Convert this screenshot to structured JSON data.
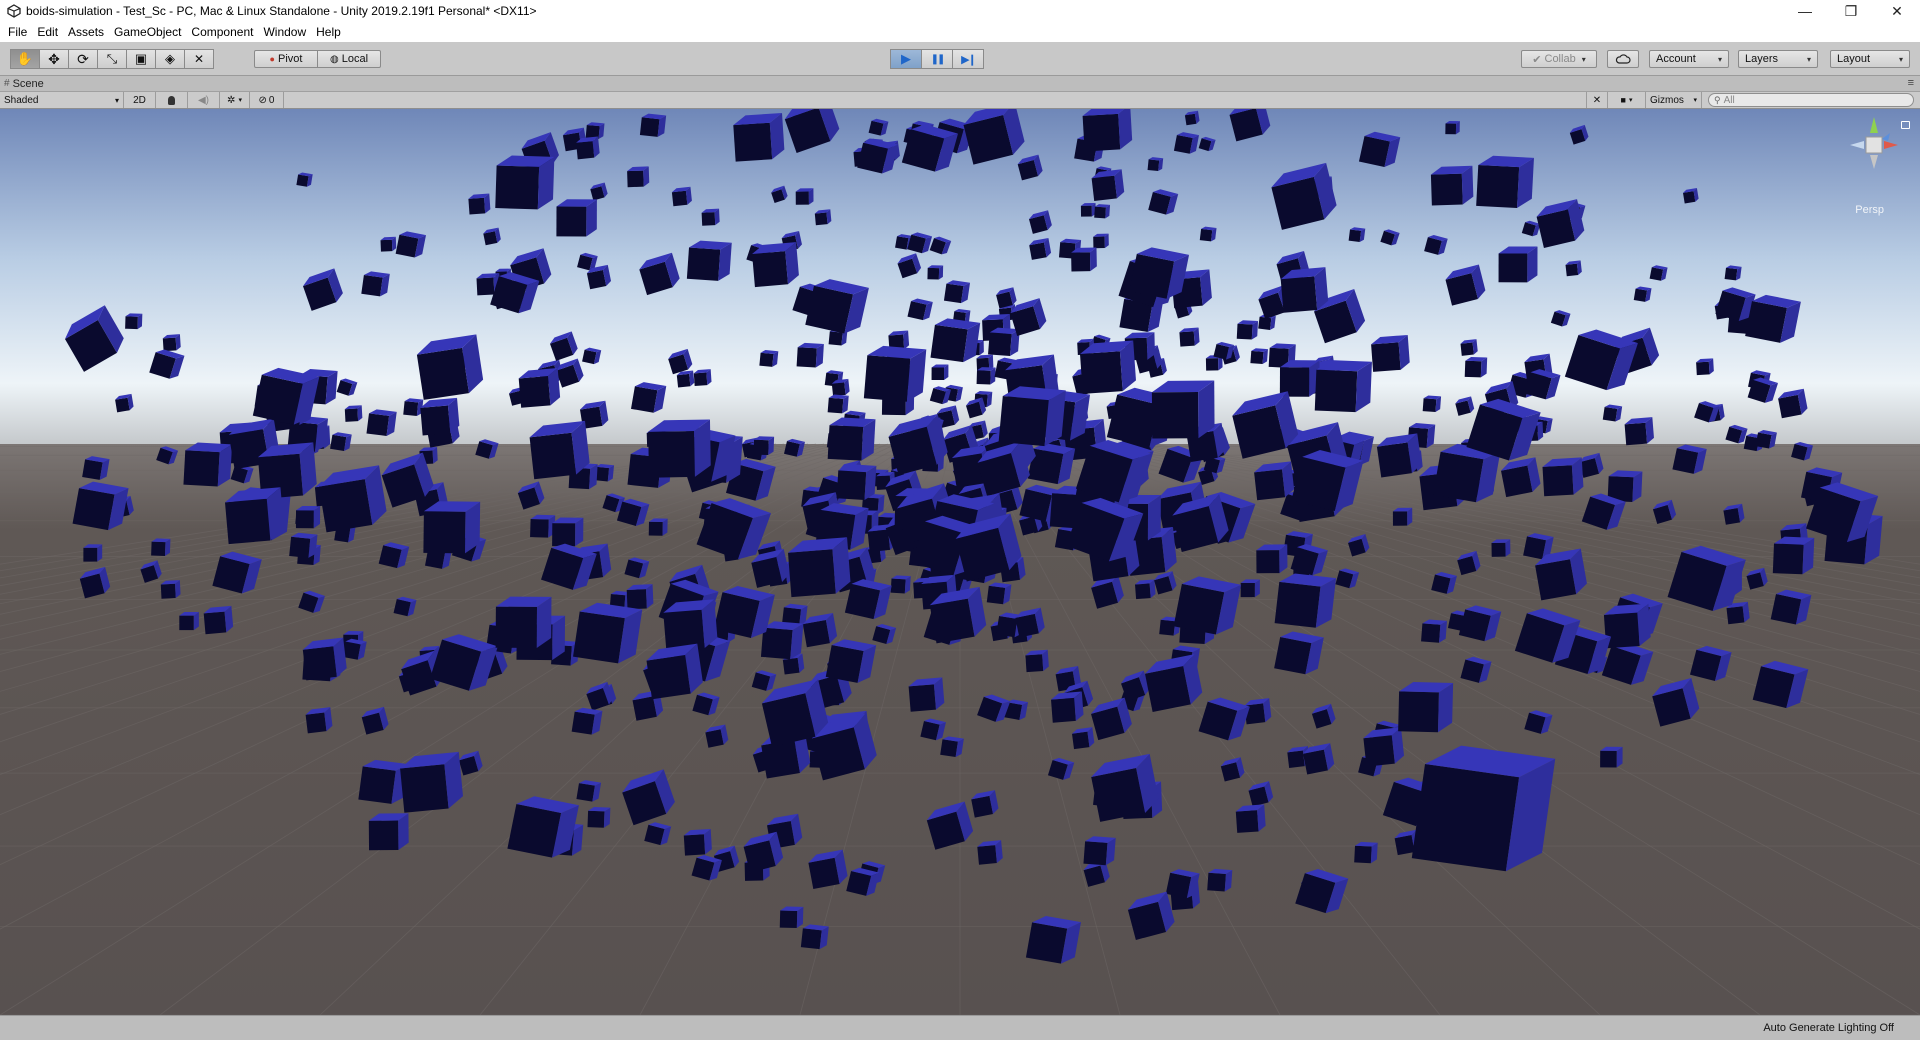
{
  "window": {
    "title": "boids-simulation - Test_Sc - PC, Mac & Linux Standalone - Unity 2019.2.19f1 Personal* <DX11>",
    "minimize_glyph": "—",
    "maximize_glyph": "❐",
    "close_glyph": "✕"
  },
  "menu": {
    "items": [
      "File",
      "Edit",
      "Assets",
      "GameObject",
      "Component",
      "Window",
      "Help"
    ]
  },
  "toolbar": {
    "transform_tools": [
      {
        "name": "hand-tool",
        "icon": "hand-icon",
        "glyph": "✋",
        "active": true
      },
      {
        "name": "move-tool",
        "icon": "move-icon",
        "glyph": "✥",
        "active": false
      },
      {
        "name": "rotate-tool",
        "icon": "rotate-icon",
        "glyph": "⟳",
        "active": false
      },
      {
        "name": "scale-tool",
        "icon": "scale-icon",
        "glyph": "⤡",
        "active": false
      },
      {
        "name": "rect-tool",
        "icon": "rect-icon",
        "glyph": "▣",
        "active": false
      },
      {
        "name": "transform-tool",
        "icon": "transform-icon",
        "glyph": "◈",
        "active": false
      },
      {
        "name": "custom-tool",
        "icon": "tools-icon",
        "glyph": "✕",
        "active": false
      }
    ],
    "pivot_label": "Pivot",
    "local_label": "Local",
    "play_glyph": "▶",
    "pause_glyph": "❚❚",
    "step_glyph": "▶❙",
    "collab_label": "Collab",
    "account_label": "Account",
    "layers_label": "Layers",
    "layout_label": "Layout",
    "dropdown_glyph": "▾",
    "accent_color": "#3a8ee6"
  },
  "scene_tab": {
    "label": "Scene",
    "icon": "hash-icon",
    "glyph": "#",
    "menu_glyph": "≡"
  },
  "scene_toolbar": {
    "shading_mode": "Shaded",
    "mode_2d": "2D",
    "lighting_icon": "bulb-icon",
    "lighting_glyph": "💡",
    "audio_icon": "speaker-icon",
    "audio_glyph": "🔈",
    "effects_icon": "effects-icon",
    "effects_glyph": "✲",
    "hidden_icon": "eye-slash-icon",
    "hidden_glyph": "⊘",
    "hidden_count": "0",
    "tools_glyph": "✕",
    "camera_glyph": "■",
    "gizmos_label": "Gizmos",
    "search_placeholder": "All"
  },
  "scene_view": {
    "projection_label": "Persp",
    "cube_color": "#2e2e9c",
    "cube_dark": "#0a0a2e",
    "sky_top": "#6f87b8",
    "sky_horizon": "#e4eef6",
    "ground": "#5a524f"
  },
  "status_bar": {
    "text": "Auto Generate Lighting Off"
  }
}
